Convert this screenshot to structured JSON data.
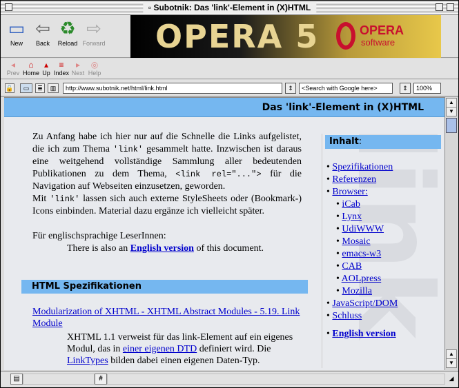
{
  "window": {
    "title": "Subotnik: Das 'link'-Element in (X)HTML"
  },
  "toolbar": {
    "new_label": "New",
    "back_label": "Back",
    "reload_label": "Reload",
    "forward_label": "Forward",
    "banner_text": "OPERA 5",
    "banner_brand": "OPERA",
    "banner_sub": "software"
  },
  "navbar": {
    "prev": "Prev",
    "home": "Home",
    "up": "Up",
    "index": "Index",
    "next": "Next",
    "help": "Help"
  },
  "address": {
    "url": "http://www.subotnik.net/html/link.html",
    "search": "<Search with Google here>",
    "zoom": "100%"
  },
  "page": {
    "header_title": "Das 'link'-Element in (X)HTML",
    "intro_1": "Zu Anfang habe ich hier nur auf die Schnelle die Links aufgelistet, die ich zum Thema",
    "intro_code": "'link'",
    "intro_2": "gesammelt hatte. Inzwischen ist daraus eine weitgehend vollständige Sammlung aller bedeutenden Publikationen zu dem Thema,",
    "intro_code2": "<link rel=\"...\">",
    "intro_3": "für die Navigation auf Webseiten einzusetzen, geworden.",
    "mit_1": "Mit",
    "mit_code": "'link'",
    "mit_2": "lassen sich auch externe StyleSheets oder (Bookmark-) Icons einbinden. Material dazu ergänze ich vielleicht später.",
    "english_prefix": "Für englischsprachige LeserInnen:",
    "english_1": "There is also an",
    "english_link": "English version",
    "english_2": "of this document.",
    "section_title": "HTML Spezifikationen",
    "spec_link": "Modularization of XHTML - XHTML Abstract Modules - 5.19. Link Module",
    "spec_1": "XHTML 1.1 verweist für das link-Element auf ein eigenes Modul, das in",
    "spec_dtd": "einer eigenen DTD",
    "spec_2": "definiert wird. Die",
    "spec_lt": "LinkTypes",
    "spec_3": "bilden dabei einen eigenen Daten-Typ."
  },
  "sidebar": {
    "title": "Inhalt",
    "title_suffix": ":",
    "items": [
      {
        "label": "Spezifikationen"
      },
      {
        "label": "Referenzen"
      },
      {
        "label": "Browser:"
      },
      {
        "label": "iCab"
      },
      {
        "label": "Lynx"
      },
      {
        "label": "UdiWWW"
      },
      {
        "label": "Mosaic"
      },
      {
        "label": "emacs-w3"
      },
      {
        "label": "CAB"
      },
      {
        "label": "AOLpress"
      },
      {
        "label": "Mozilla"
      },
      {
        "label": "JavaScript/DOM"
      },
      {
        "label": "Schluss"
      },
      {
        "label": "English version"
      }
    ]
  },
  "watermark": "link",
  "status": {
    "hash": "#"
  }
}
